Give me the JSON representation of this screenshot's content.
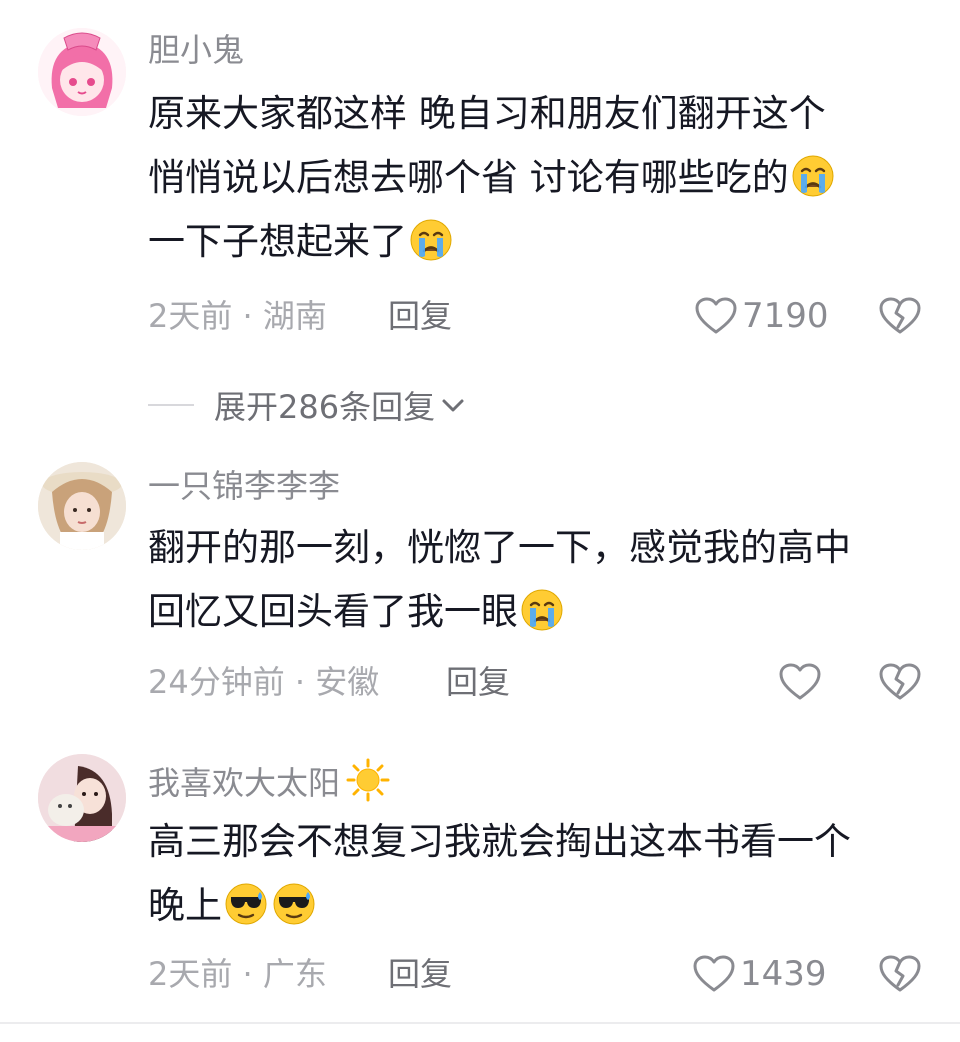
{
  "comments": [
    {
      "username": "胆小鬼",
      "lines": [
        "原来大家都这样 晚自习和朋友们翻开这个",
        "悄悄说以后想去哪个省 讨论有哪些吃的",
        "一下子想起来了"
      ],
      "emojis": [
        "crying-emoji",
        "crying-emoji"
      ],
      "time": "2天前",
      "sep": "·",
      "location": "湖南",
      "reply_label": "回复",
      "like_count": "7190",
      "expand_label": "展开286条回复"
    },
    {
      "username": "一只锦李李李",
      "lines": [
        "翻开的那一刻，恍惚了一下，感觉我的高中",
        "回忆又回头看了我一眼"
      ],
      "emojis": [
        "crying-emoji"
      ],
      "time": "24分钟前",
      "sep": "·",
      "location": "安徽",
      "reply_label": "回复",
      "like_count": ""
    },
    {
      "username": "我喜欢大太阳",
      "username_emoji": "sun-emoji",
      "lines": [
        "高三那会不想复习我就会掏出这本书看一个",
        "晚上"
      ],
      "emojis": [
        "sunglasses-sweat-emoji",
        "sunglasses-sweat-emoji"
      ],
      "time": "2天前",
      "sep": "·",
      "location": "广东",
      "reply_label": "回复",
      "like_count": "1439"
    }
  ],
  "colors": {
    "text": "#161823",
    "secondary": "#8a8b91",
    "emoji_yellow": "#ffcc33",
    "tear_blue": "#4aa8ff"
  }
}
